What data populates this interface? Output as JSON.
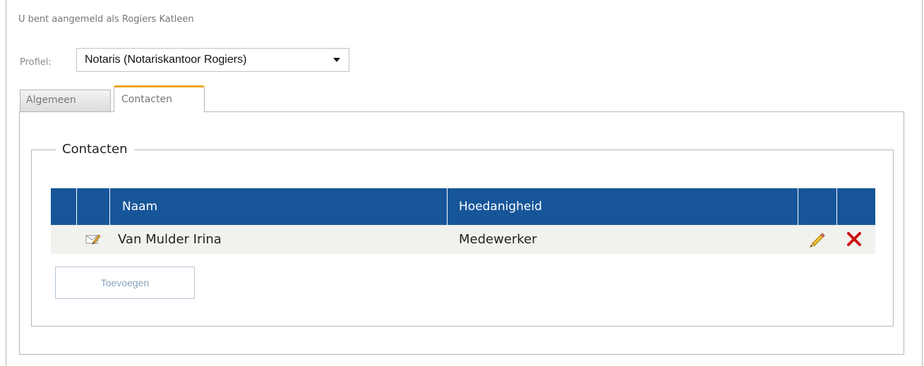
{
  "header": {
    "login_text": "U bent aangemeld als Rogiers Katleen"
  },
  "profile": {
    "label": "Profiel:",
    "selected": "Notaris (Notariskantoor Rogiers)",
    "dropdown_icon": "caret-down-icon"
  },
  "tabs": [
    {
      "label": "Algemeen",
      "active": false
    },
    {
      "label": "Contacten",
      "active": true
    }
  ],
  "contacts": {
    "legend": "Contacten",
    "columns": {
      "name": "Naam",
      "role": "Hoedanigheid"
    },
    "rows": [
      {
        "name": "Van Mulder Irina",
        "role": "Medewerker",
        "icons": {
          "message": "envelope-pencil-icon",
          "edit": "pencil-icon",
          "delete": "red-x-icon"
        }
      }
    ],
    "add_button_label": "Toevoegen"
  },
  "colors": {
    "header_blue": "#175599",
    "active_tab_accent": "#f5a623",
    "row_background": "#f1f1ee",
    "delete_red": "#cc1111"
  }
}
